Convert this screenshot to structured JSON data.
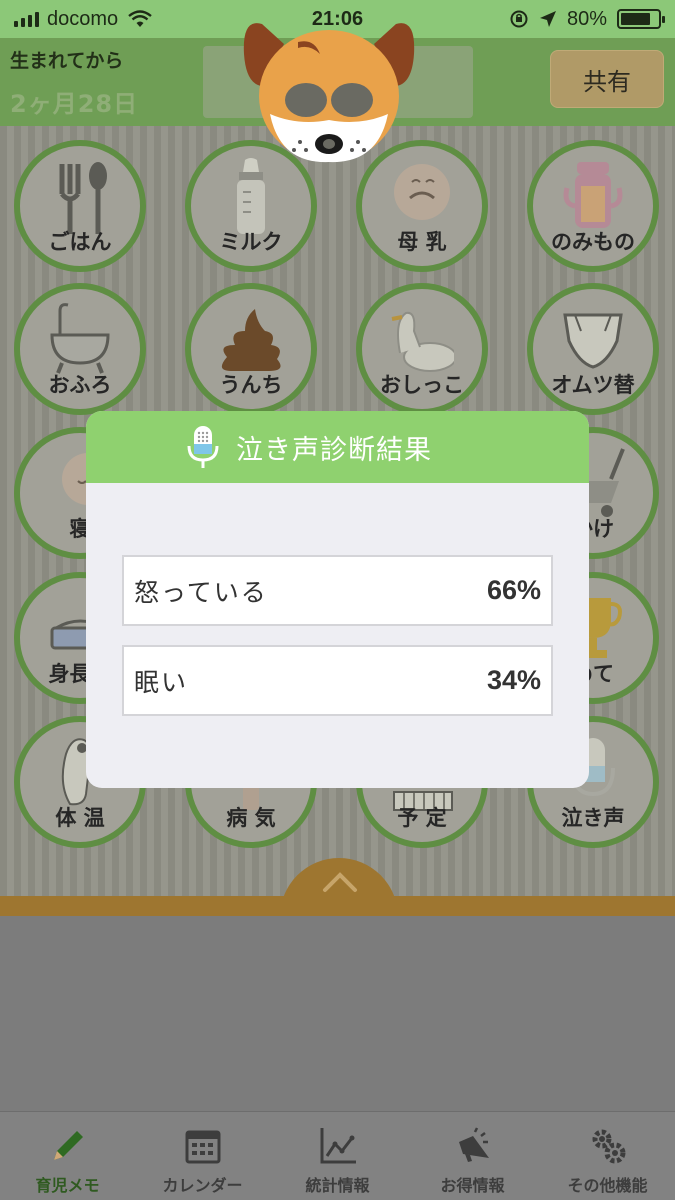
{
  "status_bar": {
    "carrier": "docomo",
    "time": "21:06",
    "battery": "80%",
    "battery_level": 0.8
  },
  "header": {
    "born_label": "生まれてから",
    "age": "2ヶ月28日",
    "share_label": "共有"
  },
  "grid": {
    "items": [
      {
        "label": "ごはん",
        "icon": "fork-spoon-icon"
      },
      {
        "label": "ミルク",
        "icon": "baby-bottle-icon"
      },
      {
        "label": "母 乳",
        "icon": "nursing-baby-icon"
      },
      {
        "label": "のみもの",
        "icon": "sippy-cup-icon"
      },
      {
        "label": "おふろ",
        "icon": "bathtub-icon"
      },
      {
        "label": "うんち",
        "icon": "poop-icon"
      },
      {
        "label": "おしっこ",
        "icon": "potty-duck-icon"
      },
      {
        "label": "オムツ替",
        "icon": "diaper-icon"
      },
      {
        "label": "寝",
        "icon": "sleeping-baby-icon"
      },
      {
        "label": "",
        "icon": "hidden"
      },
      {
        "label": "",
        "icon": "hidden"
      },
      {
        "label": "かけ",
        "icon": "stroller-icon"
      },
      {
        "label": "身長・",
        "icon": "scale-icon"
      },
      {
        "label": "",
        "icon": "hidden"
      },
      {
        "label": "",
        "icon": "hidden"
      },
      {
        "label": "めて",
        "icon": "trophy-icon"
      },
      {
        "label": "体 温",
        "icon": "thermometer-icon"
      },
      {
        "label": "病 気",
        "icon": "medicine-icon"
      },
      {
        "label": "予 定",
        "icon": "calendar-grid-icon"
      },
      {
        "label": "泣き声",
        "icon": "microphone-icon"
      }
    ]
  },
  "modal": {
    "title": "泣き声診断結果",
    "results": [
      {
        "label": "怒っている",
        "percent": "66%"
      },
      {
        "label": "眠い",
        "percent": "34%"
      }
    ]
  },
  "tabs": [
    {
      "label": "育児メモ",
      "icon": "pencil-icon",
      "active": true
    },
    {
      "label": "カレンダー",
      "icon": "calendar-icon",
      "active": false
    },
    {
      "label": "統計情報",
      "icon": "chart-icon",
      "active": false
    },
    {
      "label": "お得情報",
      "icon": "megaphone-icon",
      "active": false
    },
    {
      "label": "その他機能",
      "icon": "gears-icon",
      "active": false
    }
  ],
  "colors": {
    "header_green": "#6f9e55",
    "modal_header_green": "#8fd16f",
    "active_tab": "#2f5a20"
  }
}
